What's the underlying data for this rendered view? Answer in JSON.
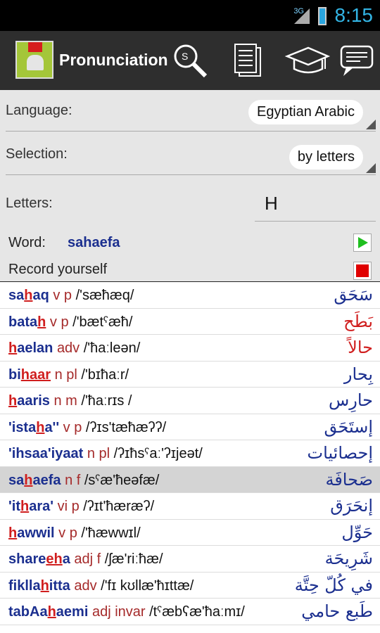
{
  "status": {
    "network": "3G",
    "time": "8:15"
  },
  "header": {
    "title": "Pronunciation",
    "icons": [
      "search-icon",
      "documents-icon",
      "graduation-cap-icon",
      "chat-icon"
    ]
  },
  "settings": {
    "language_label": "Language:",
    "language_value": "Egyptian Arabic",
    "selection_label": "Selection:",
    "selection_value": "by letters",
    "letters_label": "Letters:",
    "letters_value": "H",
    "word_label": "Word:",
    "word_value": "sahaefa",
    "record_label": "Record yourself"
  },
  "colors": {
    "word": "#1b2f8f",
    "highlight": "#d01e1e",
    "pos": "#a52a2a",
    "selected_row": "#d4d4d4"
  },
  "items": [
    {
      "pre": "sa",
      "hl": "h",
      "post": "aq",
      "pos": "v p",
      "ipa": "/'sæħæq/",
      "arabic": "سَحَق",
      "arabic_red": false
    },
    {
      "pre": "bata",
      "hl": "h",
      "post": "",
      "pos": "v p",
      "ipa": "/'bætˤæħ/",
      "arabic": "بَطَح",
      "arabic_red": true
    },
    {
      "pre": "",
      "hl": "h",
      "post": "aelan",
      "pos": "adv",
      "ipa": "/'ħaːleən/",
      "arabic": "حالاً",
      "arabic_red": true
    },
    {
      "pre": "bi",
      "hl": "haar",
      "post": "",
      "pos": "n pl",
      "ipa": "/'bɪħaːr/",
      "arabic": "بِحار",
      "arabic_red": false
    },
    {
      "pre": "",
      "hl": "h",
      "post": "aaris",
      "pos": "n m",
      "ipa": "/'ħaːrɪs /",
      "arabic": "حارِس",
      "arabic_red": false
    },
    {
      "pre": "'ista",
      "hl": "h",
      "post": "a''",
      "pos": "v p",
      "ipa": "/ʔɪs'tæħæʔʔ/",
      "arabic": "إستَحَق",
      "arabic_red": false
    },
    {
      "pre": "'ihsaa'iyaat",
      "hl": "",
      "post": "",
      "pos": "n pl",
      "ipa": "/ʔɪħsˤaː'ʔɪjeət/",
      "arabic": "إحصائيات",
      "arabic_red": false
    },
    {
      "pre": "sa",
      "hl": "h",
      "post": "aefa",
      "pos": "n f",
      "ipa": "/sˤæ'ħeəfæ/",
      "arabic": "صَحافَة",
      "arabic_red": false,
      "selected": true
    },
    {
      "pre": "'it",
      "hl": "h",
      "post": "ara'",
      "pos": "vi p",
      "ipa": "/ʔɪt'ħæræʔ/",
      "arabic": "إنحَرَق",
      "arabic_red": false
    },
    {
      "pre": "",
      "hl": "h",
      "post": "awwil",
      "pos": "v p",
      "ipa": "/'ħæwwɪl/",
      "arabic": "حَوِّل",
      "arabic_red": false
    },
    {
      "pre": "share",
      "hl": "eh",
      "post": "a",
      "pos": "adj f",
      "ipa": "/ʃæ'riːħæ/",
      "arabic": "شَرِيحَة",
      "arabic_red": false
    },
    {
      "pre": "fiklla",
      "hl": "h",
      "post": "itta",
      "pos": "adv",
      "ipa": "/'fɪ kʊllæ'ħɪttæ/",
      "arabic": "في كُلّ حِتَّة",
      "arabic_red": false
    },
    {
      "pre": "tabAa",
      "hl": "h",
      "post": "aemi",
      "pos": "adj invar",
      "ipa": "/tˤæbʕæ'ħaːmɪ/",
      "arabic": "طَبع حامي",
      "arabic_red": false
    }
  ]
}
